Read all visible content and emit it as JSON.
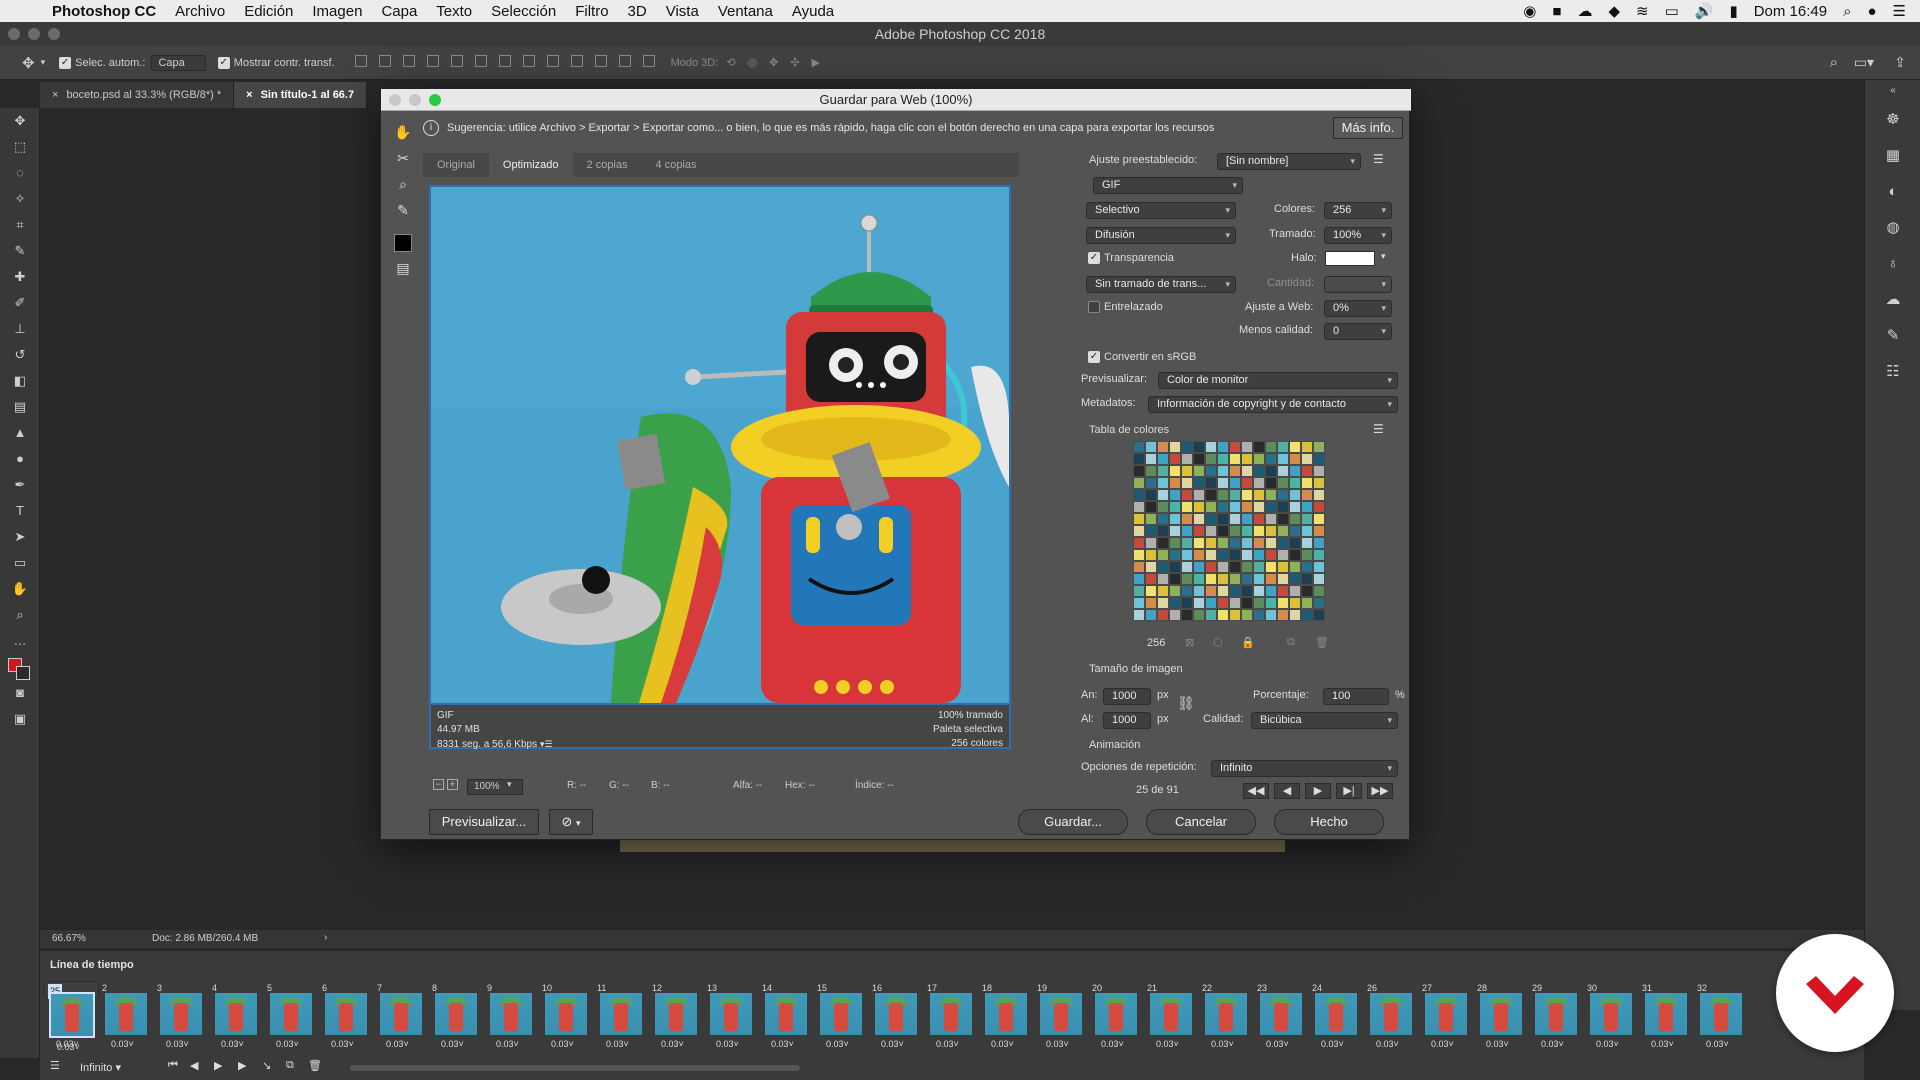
{
  "menubar": {
    "app_name": "Photoshop CC",
    "items": [
      "Archivo",
      "Edición",
      "Imagen",
      "Capa",
      "Texto",
      "Selección",
      "Filtro",
      "3D",
      "Vista",
      "Ventana",
      "Ayuda"
    ],
    "clock": "Dom 16:49"
  },
  "window": {
    "title": "Adobe Photoshop CC 2018"
  },
  "options": {
    "auto_select_label": "Selec. autom.:",
    "auto_select_value": "Capa",
    "show_transform_label": "Mostrar contr. transf.",
    "mode_3d": "Modo 3D:"
  },
  "doc_tabs": [
    {
      "label": "boceto.psd al 33.3% (RGB/8*) *"
    },
    {
      "label": "Sin título-1 al 66.7"
    }
  ],
  "dialog": {
    "title": "Guardar para Web (100%)",
    "hint": "Sugerencia: utilice Archivo > Exportar > Exportar como... o bien, lo que es más rápido, haga clic con el botón derecho en una capa para exportar los recursos",
    "more_info": "Más info.",
    "view_tabs": [
      "Original",
      "Optimizado",
      "2 copias",
      "4 copias"
    ],
    "image_info": {
      "format": "GIF",
      "size": "44.97 MB",
      "time": "8331 seg. a 56,6 Kbps",
      "dither": "100% tramado",
      "palette": "Paleta selectiva",
      "colors": "256 colores"
    },
    "zoom": "100%",
    "readouts": {
      "r": "R: --",
      "g": "G: --",
      "b": "B: --",
      "alpha": "Alfa: --",
      "hex": "Hex: --",
      "index": "Índice: --"
    },
    "preview_button": "Previsualizar...",
    "save_button": "Guardar...",
    "cancel_button": "Cancelar",
    "done_button": "Hecho",
    "settings": {
      "preset_label": "Ajuste preestablecido:",
      "preset_value": "[Sin nombre]",
      "format": "GIF",
      "reduction": "Selectivo",
      "colors_label": "Colores:",
      "colors_value": "256",
      "dither_algo": "Difusión",
      "dither_label": "Tramado:",
      "dither_value": "100%",
      "transparency_label": "Transparencia",
      "halo_label": "Halo:",
      "transp_dither": "Sin tramado de trans...",
      "amount_label": "Cantidad:",
      "interlaced_label": "Entrelazado",
      "web_snap_label": "Ajuste a Web:",
      "web_snap_value": "0%",
      "lossy_label": "Menos calidad:",
      "lossy_value": "0",
      "srgb_label": "Convertir en sRGB",
      "preview_label": "Previsualizar:",
      "preview_value": "Color de monitor",
      "metadata_label": "Metadatos:",
      "metadata_value": "Información de copyright y de contacto",
      "color_table_label": "Tabla de colores",
      "color_count": "256",
      "image_size_label": "Tamaño de imagen",
      "width_label": "An:",
      "width_value": "1000",
      "height_label": "Al:",
      "height_value": "1000",
      "px": "px",
      "percent_label": "Porcentaje:",
      "percent_value": "100",
      "percent_sign": "%",
      "quality_label": "Calidad:",
      "quality_value": "Bicúbica",
      "animation_label": "Animación",
      "loop_label": "Opciones de repetición:",
      "loop_value": "Infinito",
      "frame_counter": "25 de 91"
    }
  },
  "status": {
    "zoom": "66.67%",
    "doc": "Doc: 2.86 MB/260.4 MB"
  },
  "timeline": {
    "title": "Línea de tiempo",
    "loop": "Infinito",
    "frame_delay": "0.03",
    "selected_frame": 25,
    "frame_count_visible": 32
  },
  "colors": {
    "accent": "#2f6fb0",
    "sky": "#4aa4cf",
    "brand_red": "#d7141f"
  }
}
